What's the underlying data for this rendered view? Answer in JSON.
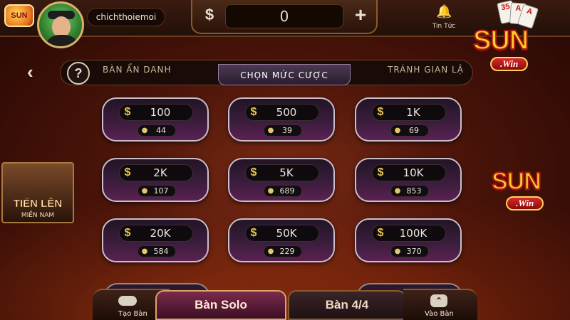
{
  "header": {
    "small_logo_text": "SUN",
    "username": "chichthoiemoi",
    "balance": "0",
    "currency_symbol": "$",
    "plus_symbol": "+",
    "news_label": "Tin Tức",
    "deco_card_number": "35"
  },
  "brand": {
    "logo_main": "SUN",
    "logo_sub": ".Win"
  },
  "tabs": {
    "help_symbol": "?",
    "items": [
      {
        "label": "BÀN ẨN DANH",
        "active": false
      },
      {
        "label": "CHỌN MỨC CƯỢC",
        "active": true
      },
      {
        "label": "TRÁNH GIAN LẬ",
        "active": false
      }
    ]
  },
  "bets": [
    {
      "amount": "100",
      "players": "44"
    },
    {
      "amount": "500",
      "players": "39"
    },
    {
      "amount": "1K",
      "players": "69"
    },
    {
      "amount": "2K",
      "players": "107"
    },
    {
      "amount": "5K",
      "players": "689"
    },
    {
      "amount": "10K",
      "players": "853"
    },
    {
      "amount": "20K",
      "players": "584"
    },
    {
      "amount": "50K",
      "players": "229"
    },
    {
      "amount": "100K",
      "players": "370"
    }
  ],
  "side_game": {
    "title": "TIẾN LÊN",
    "subtitle": "MIỀN NAM"
  },
  "bottom": {
    "create_table": "Tạo Bàn",
    "solo": "Bàn Solo",
    "four": "Bàn 4/4",
    "join_table": "Vào Bàn"
  },
  "colors": {
    "accent_gold": "#e7c454",
    "brand_red": "#a5190e",
    "card_border": "#c9c0cc"
  }
}
